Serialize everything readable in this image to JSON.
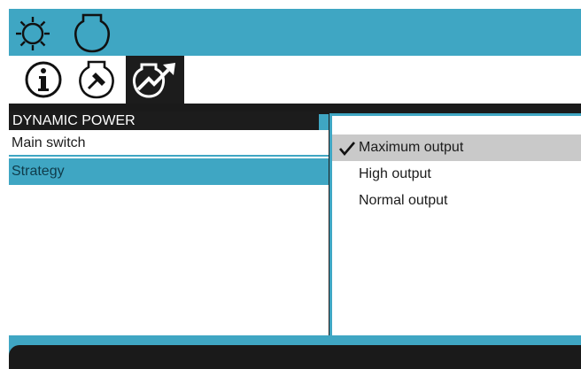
{
  "colors": {
    "accent": "#3fa6c3",
    "dark": "#1c1c1c",
    "highlight": "#c9c9c9",
    "background": "#ffffff"
  },
  "top_bar": {
    "icons": [
      "sun-gear-icon",
      "engine-bulb-icon"
    ]
  },
  "tabs": [
    {
      "icon": "info-icon",
      "active": false
    },
    {
      "icon": "engine-hammer-icon",
      "active": false
    },
    {
      "icon": "dynamic-power-icon",
      "active": true
    }
  ],
  "section": {
    "title": "DYNAMIC POWER"
  },
  "menu": {
    "items": [
      {
        "label": "Main switch",
        "selected": false
      },
      {
        "label": "Strategy",
        "selected": true
      }
    ]
  },
  "dropdown": {
    "options": [
      {
        "label": "Maximum output",
        "checked": true
      },
      {
        "label": "High output",
        "checked": false
      },
      {
        "label": "Normal output",
        "checked": false
      }
    ]
  }
}
